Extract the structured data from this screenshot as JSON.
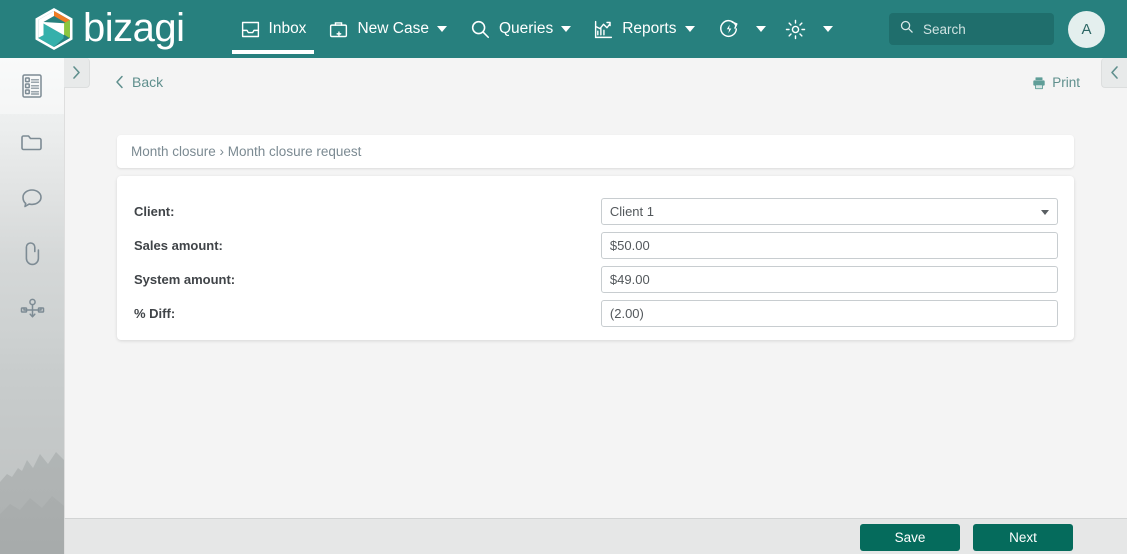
{
  "brand": {
    "name": "bizagi",
    "logo_icon": "bizagi-hexagon-logo",
    "colors": {
      "header_teal": "#27807e",
      "logo_orange": "#f07d25",
      "logo_green": "#8cc63e",
      "logo_teal": "#35b0ab",
      "button_green": "#056b5c",
      "link_teal": "#5f8f8d"
    }
  },
  "topnav": {
    "items": [
      {
        "label": "Inbox",
        "icon": "inbox-tray-icon",
        "has_caret": false,
        "active": true
      },
      {
        "label": "New Case",
        "icon": "briefcase-plus-icon",
        "has_caret": true,
        "active": false
      },
      {
        "label": "Queries",
        "icon": "magnifier-icon",
        "has_caret": true,
        "active": false
      },
      {
        "label": "Reports",
        "icon": "bar-chart-arrow-icon",
        "has_caret": true,
        "active": false
      },
      {
        "label": "",
        "icon": "refresh-power-circle-icon",
        "has_caret": true,
        "active": false
      },
      {
        "label": "",
        "icon": "gear-icon",
        "has_caret": true,
        "active": false
      }
    ]
  },
  "search": {
    "icon": "search-icon",
    "placeholder": "Search",
    "value": ""
  },
  "user": {
    "avatar_initial": "A"
  },
  "sidebar": {
    "expand_icon": "chevron-right-icon",
    "items": [
      {
        "icon": "form-list-icon",
        "selected": true
      },
      {
        "icon": "folder-icon",
        "selected": false
      },
      {
        "icon": "comment-bubble-icon",
        "selected": false
      },
      {
        "icon": "paperclip-icon",
        "selected": false
      },
      {
        "icon": "process-diagram-icon",
        "selected": false
      }
    ]
  },
  "right_panel": {
    "collapse_icon": "chevron-left-icon"
  },
  "toolbar": {
    "back_label": "Back",
    "back_icon": "chevron-left-icon",
    "print_label": "Print",
    "print_icon": "printer-icon"
  },
  "breadcrumb": {
    "text": "Month closure › Month closure request",
    "parent": "Month closure",
    "current": "Month closure request"
  },
  "form": {
    "fields": [
      {
        "label": "Client:",
        "type": "select",
        "value": "Client 1",
        "caret_icon": "chevron-down-icon",
        "name": "client"
      },
      {
        "label": "Sales amount:",
        "type": "text",
        "value": "$50.00",
        "name": "sales-amount"
      },
      {
        "label": "System amount:",
        "type": "text",
        "value": "$49.00",
        "name": "system-amount"
      },
      {
        "label": "% Diff:",
        "type": "text",
        "value": "(2.00)",
        "name": "percent-diff"
      }
    ]
  },
  "footer": {
    "save_label": "Save",
    "next_label": "Next"
  }
}
